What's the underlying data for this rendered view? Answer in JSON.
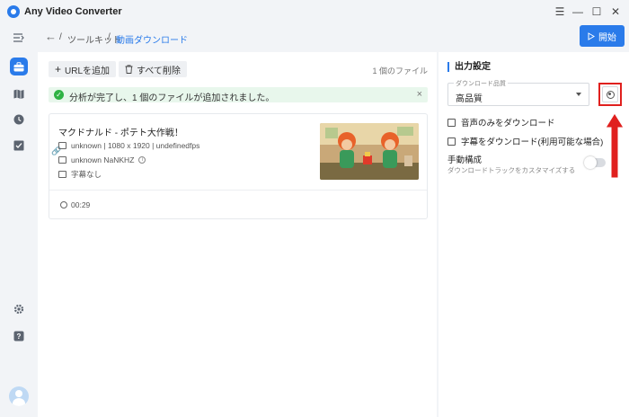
{
  "app": {
    "title": "Any Video Converter"
  },
  "window": {
    "menu_icon": "menu-icon",
    "minimize_icon": "minimize-icon",
    "maximize_icon": "maximize-icon",
    "close_icon": "close-icon"
  },
  "breadcrumb": {
    "separator": "/",
    "parent": "ツールキット",
    "current": "動画ダウンロード"
  },
  "toolbar": {
    "start_label": "開始",
    "add_url_label": "URLを追加",
    "delete_all_label": "すべて削除",
    "file_count": "1 個のファイル"
  },
  "alert": {
    "message": "分析が完了し、1 個のファイルが追加されました。",
    "close": "×"
  },
  "video": {
    "title": "マクドナルド - ポテト大作戦！",
    "format_line": "unknown | 1080 x 1920 | undefinedfps",
    "audio_line": "unknown  NaNKHZ",
    "subtitle_line": "字幕なし",
    "duration": "00:29"
  },
  "settings": {
    "title": "出力設定",
    "quality_label": "ダウンロード品質",
    "quality_value": "高品質",
    "audio_only_label": "音声のみをダウンロード",
    "subtitles_label": "字幕をダウンロード(利用可能な場合)",
    "manual_title": "手動構成",
    "manual_sub": "ダウンロードトラックをカスタマイズする",
    "manual_enabled": false
  },
  "colors": {
    "accent": "#2a7bea",
    "success": "#2fb344",
    "highlight": "#e0201e"
  }
}
